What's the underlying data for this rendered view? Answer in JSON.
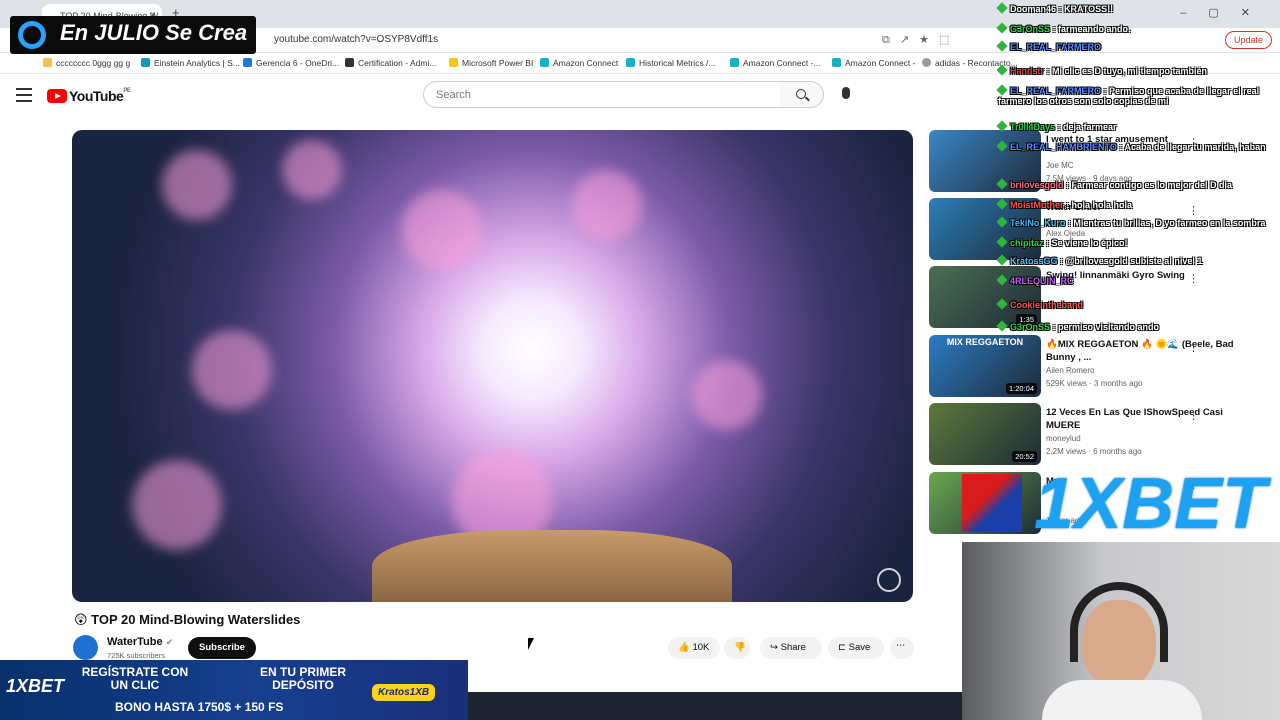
{
  "browser": {
    "tab_title": "TOP 20 Mind-Blowing W",
    "url": "youtube.com/watch?v=OSYP8Vdff1s",
    "update_label": "Update",
    "bookmarks": [
      "cccccccc 0ggg gg g",
      "Einstein Analytics | S...",
      "Gerencia 6 - OneDri...",
      "Certification - Admi...",
      "Microsoft Power BI",
      "Amazon Connect",
      "Historical Metrics /...",
      "Amazon Connect -...",
      "Amazon Connect -",
      "adidas - Recontacto..."
    ]
  },
  "youtube": {
    "logo": "YouTube",
    "country": "PE",
    "search_placeholder": "Search"
  },
  "video": {
    "title": "😲 TOP 20 Mind-Blowing Waterslides",
    "channel": "WaterTube",
    "subscribers": "725K subscribers",
    "subscribe_label": "Subscribe",
    "likes": "10K",
    "share_label": "Share",
    "save_label": "Save"
  },
  "recommendations": [
    {
      "title": "I went to 1 star amusement",
      "channel": "Joe MC",
      "meta": "7.5M views · 9 days ago",
      "duration": "",
      "accent": "#3a86c8"
    },
    {
      "title": "Water Slide!",
      "channel": "Alex Ojeda",
      "meta": "",
      "duration": "",
      "accent": "#2a7fb8"
    },
    {
      "title": "Swing! linnanmäki Gyro Swing",
      "channel": "",
      "meta": "",
      "duration": "1:35",
      "accent": "#4a6f52"
    },
    {
      "title": "🔥MIX REGGAETON 🔥 🌞🌊 (Beele, Bad Bunny , ...",
      "channel": "Ailen Romero",
      "meta": "529K views · 3 months ago",
      "duration": "1:20:04",
      "accent": "#2b7cc4",
      "thumb_text": "MIX REGGAETON"
    },
    {
      "title": "12 Veces En Las Que IShowSpeed Casi MUERE",
      "channel": "moneylud",
      "meta": "2.2M views · 6 months ago",
      "duration": "20:52",
      "accent": "#5d7a3a"
    },
    {
      "title": "My",
      "channel": "",
      "meta": "1 year ago",
      "duration": "",
      "accent": "#6aa84f"
    }
  ],
  "overlays": {
    "stream_title": "En JULIO Se Crea",
    "bet_logo": "1XBET",
    "chat": [
      {
        "user": "Dooman46",
        "msg": "KRATOSS!!",
        "color": "#ffffff"
      },
      {
        "user": "G3rOnSS",
        "msg": "farmeando ando.",
        "color": "#2fd04a"
      },
      {
        "user": "EL_REAL_FARMERO",
        "msg": "",
        "color": "#5a8dff"
      },
      {
        "user": "Handstr",
        "msg": "Mi clic es D tuyo, mi tiempo también",
        "color": "#d04040"
      },
      {
        "user": "EL_REAL_FARMERO",
        "msg": "Permiso que acaba de llegar el real farmero los otros son solo copias de mi",
        "color": "#5a8dff"
      },
      {
        "user": "Tr0ll4Days",
        "msg": "deja farmear",
        "color": "#2fd04a"
      },
      {
        "user": "EL_REAL_HAMBRIENTO",
        "msg": "Acaba de llegar tu marida, haban",
        "color": "#5a8dff"
      },
      {
        "user": "brilovesgold",
        "msg": "Farmear contigo es lo mejor del D dia",
        "color": "#ff6a8a"
      },
      {
        "user": "MoistMother",
        "msg": "hola hola hola",
        "color": "#ff5050"
      },
      {
        "user": "TekiNo_Kuro",
        "msg": "Mientras tu brillas, D yo farmeo en la sombra",
        "color": "#40c0ff"
      },
      {
        "user": "chipitaz",
        "msg": "Se viene lo épico!",
        "color": "#2fd04a"
      },
      {
        "user": "KratossGG",
        "msg": "@brilovesgold subiste al nivel 1",
        "color": "#40c0ff"
      },
      {
        "user": "4RLEQUIN_RC",
        "msg": "",
        "color": "#c060ff"
      },
      {
        "user": "Cookieintheband",
        "msg": "",
        "color": "#ff5050"
      },
      {
        "user": "G3rOnSS",
        "msg": "permiso visitando ando",
        "color": "#2fd04a"
      }
    ]
  },
  "banner": {
    "line1": "REGÍSTRATE CON UN CLIC",
    "line2": "EN TU PRIMER DEPÓSITO",
    "bonus": "BONO HASTA 1750$ + 150 FS",
    "badge": "Kratos1XB",
    "logo": "1XBET"
  }
}
